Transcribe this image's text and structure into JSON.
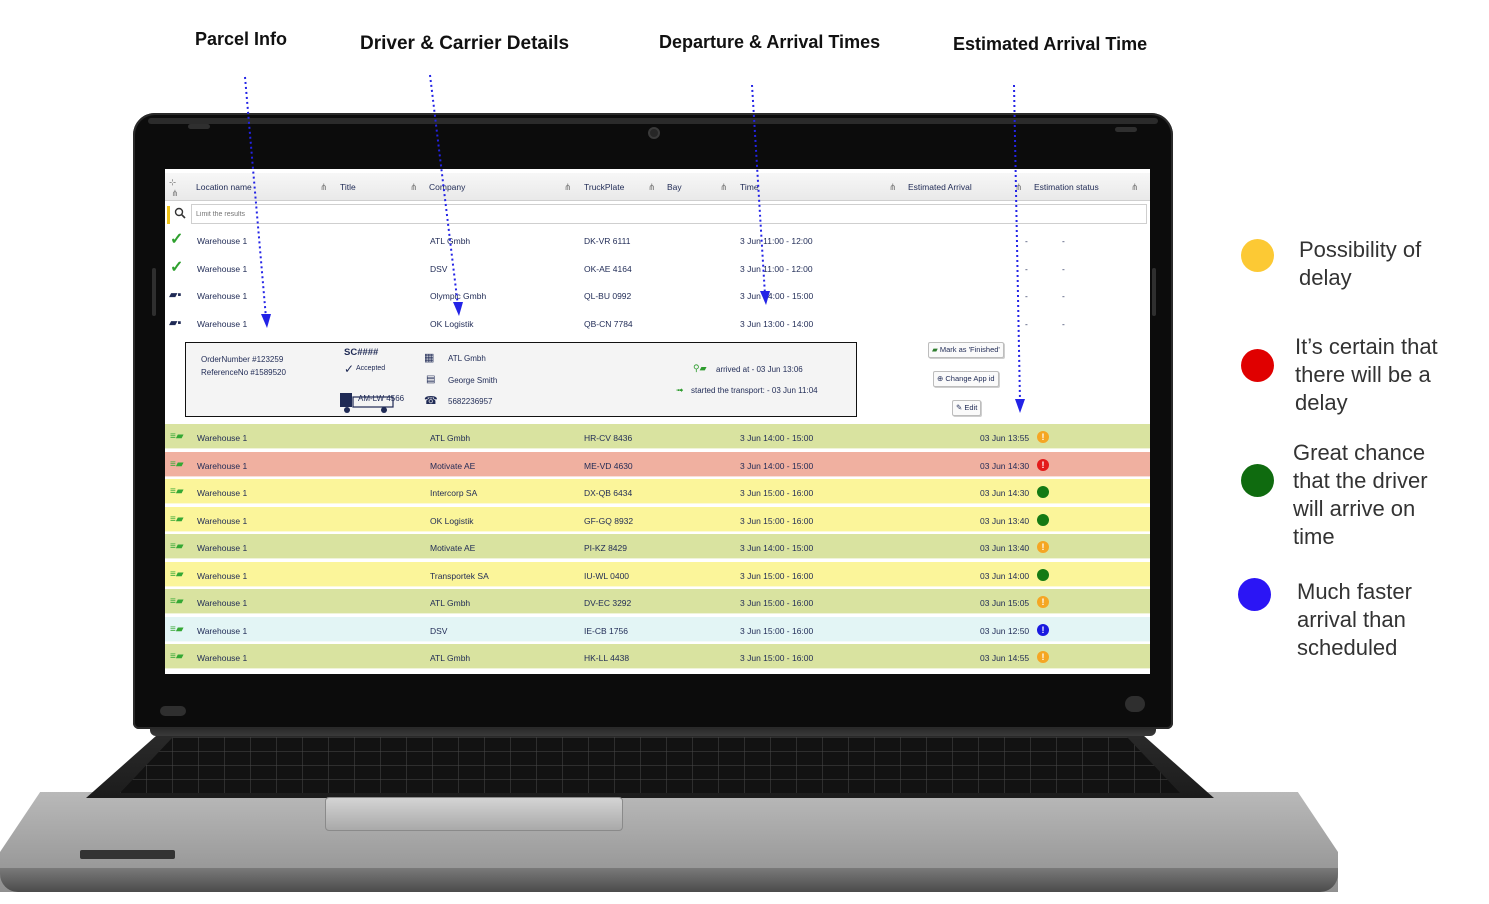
{
  "annotations": [
    {
      "label": "Parcel Info"
    },
    {
      "label": "Driver & Carrier Details"
    },
    {
      "label": "Departure & Arrival Times"
    },
    {
      "label": "Estimated Arrival Time"
    }
  ],
  "table": {
    "headers": [
      "Location name",
      "Title",
      "Company",
      "TruckPlate",
      "Bay",
      "Time",
      "Estimated Arrival",
      "Estimation status"
    ],
    "filter_placeholder": "Limit the results",
    "plain_rows": [
      {
        "status_icon": "checkmark-icon",
        "location": "Warehouse 1",
        "company": "ATL Gmbh",
        "plate": "DK-VR 6111",
        "time": "3 Jun 11:00 - 12:00",
        "eta": "-",
        "est": "-"
      },
      {
        "status_icon": "checkmark-icon",
        "location": "Warehouse 1",
        "company": "DSV",
        "plate": "OK-AE 4164",
        "time": "3 Jun 11:00 - 12:00",
        "eta": "-",
        "est": "-"
      },
      {
        "status_icon": "truck-icon",
        "location": "Warehouse 1",
        "company": "Olympic Gmbh",
        "plate": "QL-BU 0992",
        "time": "3 Jun 14:00 - 15:00",
        "eta": "-",
        "est": "-"
      },
      {
        "status_icon": "truck-icon",
        "location": "Warehouse 1",
        "company": "OK Logistik",
        "plate": "QB-CN 7784",
        "time": "3 Jun 13:00 - 14:00",
        "eta": "-",
        "est": "-"
      }
    ],
    "detail": {
      "order_number": "OrderNumber #123259",
      "reference_no": "ReferenceNo #1589520",
      "sc": "SC####",
      "accepted": "Accepted",
      "truck_plate": "AM-LW 4566",
      "company": "ATL Gmbh",
      "driver": "George Smith",
      "phone": "5682236957",
      "arrived": "arrived at - 03 Jun 13:06",
      "started": "started the transport: - 03 Jun 11:04",
      "actions": {
        "finish": "Mark as 'Finished'",
        "change": "Change App id",
        "edit": "Edit"
      }
    },
    "colored_rows": [
      {
        "location": "Warehouse 1",
        "company": "ATL Gmbh",
        "plate": "HR-CV 8436",
        "time": "3 Jun 14:00 - 15:00",
        "eta": "03 Jun 13:55",
        "bg": "#d9e3a0",
        "dot": "#f5a623",
        "mark": "!"
      },
      {
        "location": "Warehouse 1",
        "company": "Motivate AE",
        "plate": "ME-VD 4630",
        "time": "3 Jun 14:00 - 15:00",
        "eta": "03 Jun 14:30",
        "bg": "#f0b0a0",
        "dot": "#e31b1b",
        "mark": "!"
      },
      {
        "location": "Warehouse 1",
        "company": "Intercorp SA",
        "plate": "DX-QB 6434",
        "time": "3 Jun 15:00 - 16:00",
        "eta": "03 Jun 14:30",
        "bg": "#fbf59a",
        "dot": "#147a14",
        "mark": ""
      },
      {
        "location": "Warehouse 1",
        "company": "OK Logistik",
        "plate": "GF-GQ 8932",
        "time": "3 Jun 15:00 - 16:00",
        "eta": "03 Jun 13:40",
        "bg": "#fbf59a",
        "dot": "#147a14",
        "mark": ""
      },
      {
        "location": "Warehouse 1",
        "company": "Motivate AE",
        "plate": "PI-KZ 8429",
        "time": "3 Jun 14:00 - 15:00",
        "eta": "03 Jun 13:40",
        "bg": "#d9e3a0",
        "dot": "#f5a623",
        "mark": "!"
      },
      {
        "location": "Warehouse 1",
        "company": "Transportek SA",
        "plate": "IU-WL 0400",
        "time": "3 Jun 15:00 - 16:00",
        "eta": "03 Jun 14:00",
        "bg": "#fbf59a",
        "dot": "#147a14",
        "mark": ""
      },
      {
        "location": "Warehouse 1",
        "company": "ATL Gmbh",
        "plate": "DV-EC 3292",
        "time": "3 Jun 15:00 - 16:00",
        "eta": "03 Jun 15:05",
        "bg": "#d9e3a0",
        "dot": "#f5a623",
        "mark": "!"
      },
      {
        "location": "Warehouse 1",
        "company": "DSV",
        "plate": "IE-CB 1756",
        "time": "3 Jun 15:00 - 16:00",
        "eta": "03 Jun 12:50",
        "bg": "#e3f5f5",
        "dot": "#1a1ae0",
        "mark": "!"
      },
      {
        "location": "Warehouse 1",
        "company": "ATL Gmbh",
        "plate": "HK-LL 4438",
        "time": "3 Jun 15:00 - 16:00",
        "eta": "03 Jun 14:55",
        "bg": "#d9e3a0",
        "dot": "#f5a623",
        "mark": "!"
      }
    ]
  },
  "legend": [
    {
      "color": "#fcc934",
      "text": "Possibility of delay"
    },
    {
      "color": "#e00000",
      "text": "It’s certain that there will be a delay"
    },
    {
      "color": "#0f6b0f",
      "text": "Great chance that the driver will arrive on time"
    },
    {
      "color": "#2b15f5",
      "text": "Much faster arrival than scheduled"
    }
  ]
}
